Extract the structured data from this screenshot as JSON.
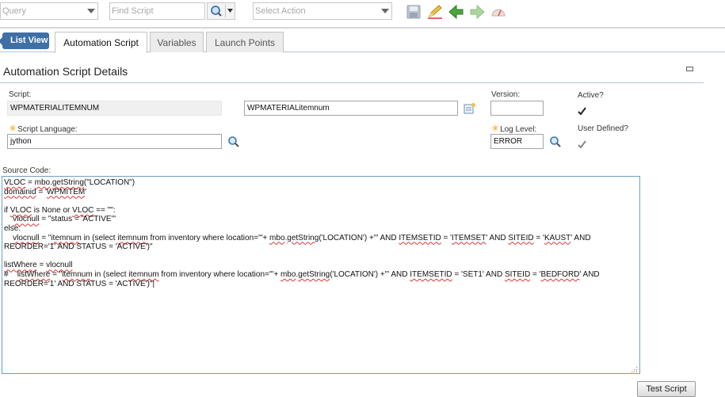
{
  "toolbar": {
    "query_placeholder": "Query",
    "find_placeholder": "Find Script",
    "action_placeholder": "Select Action"
  },
  "tabs": {
    "list_view": "List View",
    "items": [
      {
        "label": "Automation Script"
      },
      {
        "label": "Variables"
      },
      {
        "label": "Launch Points"
      }
    ]
  },
  "section": {
    "title": "Automation Script Details"
  },
  "form": {
    "script_label": "Script:",
    "script_value": "WPMATERIALITEMNUM",
    "description_value": "WPMATERIALitemnum",
    "version_label": "Version:",
    "version_value": "",
    "active_label": "Active?",
    "active_checked": true,
    "language_label": "Script Language:",
    "language_value": "jython",
    "log_level_label": "Log Level:",
    "log_level_value": "ERROR",
    "user_defined_label": "User Defined?",
    "user_defined_checked": true
  },
  "source": {
    "label": "Source Code:"
  },
  "buttons": {
    "test_script": "Test Script"
  },
  "colors": {
    "accent": "#3e6fa6",
    "required": "#f2a516"
  }
}
